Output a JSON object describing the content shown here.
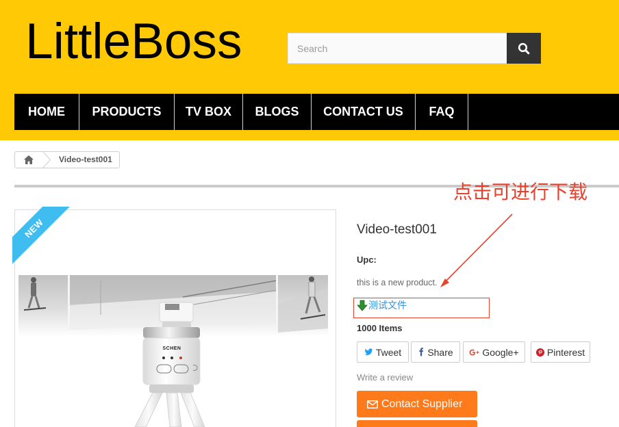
{
  "theme": {
    "header_bg": "#FFCA05",
    "nav_bg": "#000000",
    "accent": "#FF7A1A",
    "badge": "#3FBDF0",
    "link": "#3A8FD6",
    "annotation": "#E8412C"
  },
  "header": {
    "logo_text": "LittleBoss",
    "search": {
      "placeholder": "Search",
      "button_icon": "search-icon"
    }
  },
  "nav": {
    "items": [
      {
        "label": "HOME"
      },
      {
        "label": "PRODUCTS"
      },
      {
        "label": "TV BOX"
      },
      {
        "label": "BLOGS"
      },
      {
        "label": "CONTACT US"
      },
      {
        "label": "FAQ"
      }
    ]
  },
  "breadcrumb": {
    "home_icon": "home-icon",
    "current": "Video-test001"
  },
  "product": {
    "badge": "NEW",
    "image_brand": "SCHEN",
    "title": "Video-test001",
    "upc_label": "Upc:",
    "description": "this is a new product.",
    "attachment": {
      "icon": "download-arrow-icon",
      "label": "测试文件"
    },
    "stock": "1000 Items",
    "share": [
      {
        "icon": "twitter-icon",
        "label": "Tweet"
      },
      {
        "icon": "facebook-icon",
        "label": "Share"
      },
      {
        "icon": "google-plus-icon",
        "label": "Google+"
      },
      {
        "icon": "pinterest-icon",
        "label": "Pinterest"
      }
    ],
    "review_link": "Write a review",
    "contact_button": {
      "icon": "envelope-icon",
      "label": "Contact Supplier"
    }
  },
  "annotation": {
    "text": "点击可进行下载"
  }
}
